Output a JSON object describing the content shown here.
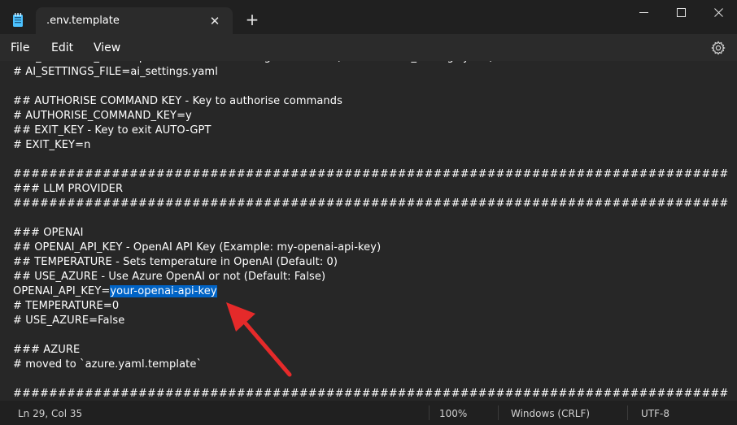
{
  "window": {
    "tab_title": ".env.template",
    "tab_close_glyph": "✕",
    "new_tab_glyph": "+"
  },
  "menu": {
    "file": "File",
    "edit": "Edit",
    "view": "View"
  },
  "editor": {
    "lines": [
      "# AI_SETTINGS_FILE - Specifies which AI Settings file to use (defaults to ai_settings.yaml)",
      "# AI_SETTINGS_FILE=ai_settings.yaml",
      "",
      "## AUTHORISE COMMAND KEY - Key to authorise commands",
      "# AUTHORISE_COMMAND_KEY=y",
      "## EXIT_KEY - Key to exit AUTO-GPT",
      "# EXIT_KEY=n",
      "",
      "################################################################################",
      "### LLM PROVIDER",
      "################################################################################",
      "",
      "### OPENAI",
      "## OPENAI_API_KEY - OpenAI API Key (Example: my-openai-api-key)",
      "## TEMPERATURE - Sets temperature in OpenAI (Default: 0)",
      "## USE_AZURE - Use Azure OpenAI or not (Default: False)",
      "__SELECTED__",
      "# TEMPERATURE=0",
      "# USE_AZURE=False",
      "",
      "### AZURE",
      "# moved to `azure.yaml.template`",
      "",
      "################################################################################"
    ],
    "selected_line_prefix": "OPENAI_API_KEY=",
    "selected_text": "your-openai-api-key",
    "selection_color": "#0063c5",
    "annotation_arrow_color": "#e52a2a"
  },
  "status": {
    "position": "Ln 29, Col 35",
    "zoom": "100%",
    "line_ending": "Windows (CRLF)",
    "encoding": "UTF-8"
  },
  "icons": {
    "app": "notepad-icon",
    "settings": "gear-icon"
  }
}
